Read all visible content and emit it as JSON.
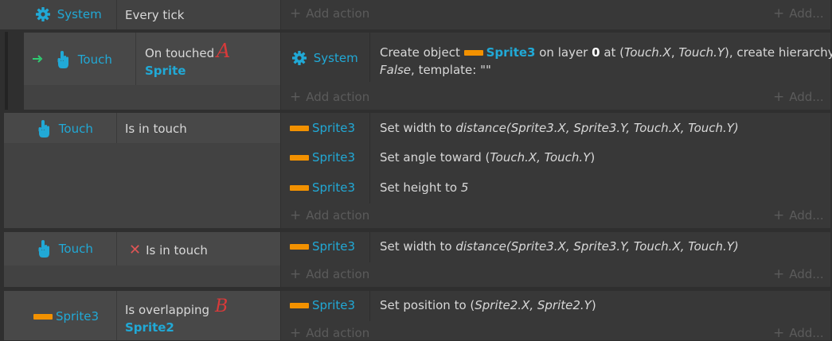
{
  "add_action_label": "Add action",
  "add_more_label": "Add...",
  "colors": {
    "object": "#21a9d6",
    "sprite_bar": "#f29100",
    "invert": "#e05555",
    "annot": "#d83a3a",
    "arrow": "#2ecc71"
  },
  "events": [
    {
      "condition_object": "System",
      "condition_text": "Every tick"
    },
    {
      "condition_object": "Touch",
      "condition_text": "On touched",
      "condition_param": "Sprite",
      "annotation": "A",
      "action_object": "System",
      "action_line1_a": "Create object ",
      "action_obj": "Sprite3",
      "action_line1_b": " on layer ",
      "action_layer": "0",
      "action_line1_c": " at (",
      "action_x": "Touch.X",
      "action_comma": ", ",
      "action_y": "Touch.Y",
      "action_line1_d": "), create hierarchy:",
      "action_false": "False",
      "action_line2": ", template: \"\""
    },
    {
      "condition_object": "Touch",
      "condition_text": "Is in touch",
      "actions": [
        {
          "object": "Sprite3",
          "text": "Set width to ",
          "expr": "distance(Sprite3.X, Sprite3.Y, Touch.X, Touch.Y)"
        },
        {
          "object": "Sprite3",
          "text": "Set angle toward (",
          "expr": "Touch.X, Touch.Y",
          "tail": ")"
        },
        {
          "object": "Sprite3",
          "text": "Set height to ",
          "expr": "5"
        }
      ]
    },
    {
      "condition_object": "Touch",
      "condition_text": "Is in touch",
      "inverted_mark": "✕",
      "actions": [
        {
          "object": "Sprite3",
          "text": "Set width to ",
          "expr": "distance(Sprite3.X, Sprite3.Y, Touch.X, Touch.Y)"
        }
      ]
    },
    {
      "condition_object": "Sprite3",
      "condition_text": "Is overlapping",
      "condition_param": "Sprite2",
      "annotation": "B",
      "actions": [
        {
          "object": "Sprite3",
          "text": "Set position to (",
          "expr": "Sprite2.X, Sprite2.Y",
          "tail": ")"
        }
      ]
    }
  ]
}
